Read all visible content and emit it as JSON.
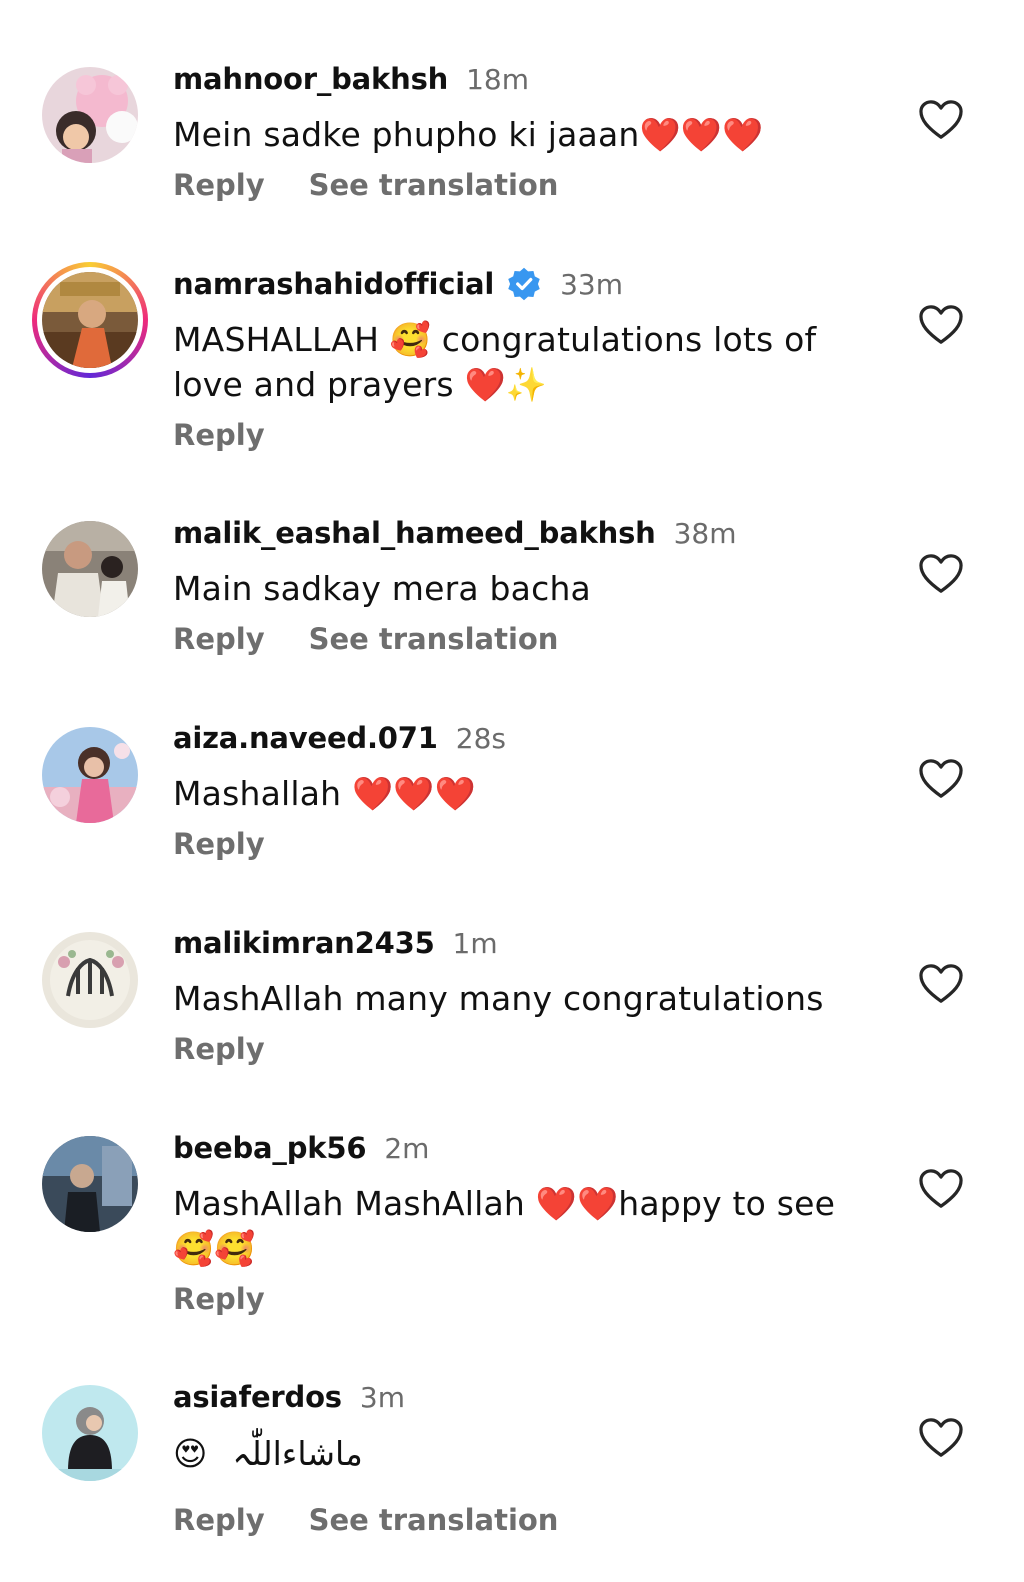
{
  "actions": {
    "reply_label": "Reply",
    "translate_label": "See translation"
  },
  "comments": [
    {
      "username": "mahnoor_bakhsh",
      "time": "18m",
      "text": "Mein sadke phupho ki jaaan❤️❤️❤️",
      "has_translation": true
    },
    {
      "username": "namrashahidofficial",
      "verified": true,
      "time": "33m",
      "text": "MASHALLAH 🥰 congratulations lots of love and prayers ❤️✨",
      "has_translation": false
    },
    {
      "username": "malik_eashal_hameed_bakhsh",
      "time": "38m",
      "text": "Main sadkay mera bacha",
      "has_translation": true
    },
    {
      "username": "aiza.naveed.071",
      "time": "28s",
      "text": "Mashallah ❤️❤️❤️",
      "has_translation": false
    },
    {
      "username": "malikimran2435",
      "time": "1m",
      "text": "MashAllah many many congratulations",
      "has_translation": false
    },
    {
      "username": "beeba_pk56",
      "time": "2m",
      "text": "MashAllah MashAllah ❤️❤️happy to see 🥰🥰",
      "has_translation": false
    },
    {
      "username": "asiaferdos",
      "time": "3m",
      "text_emoji": "😍",
      "text_arabic": "ماشاءاللّٰہ",
      "has_translation": true
    }
  ],
  "colors": {
    "username": "#111111",
    "timestamp": "#6b6b6b",
    "action": "#6e6e6e",
    "verified_badge": "#3897f0"
  },
  "icons": {
    "like": "heart-outline-icon",
    "verified": "verified-badge-icon"
  }
}
